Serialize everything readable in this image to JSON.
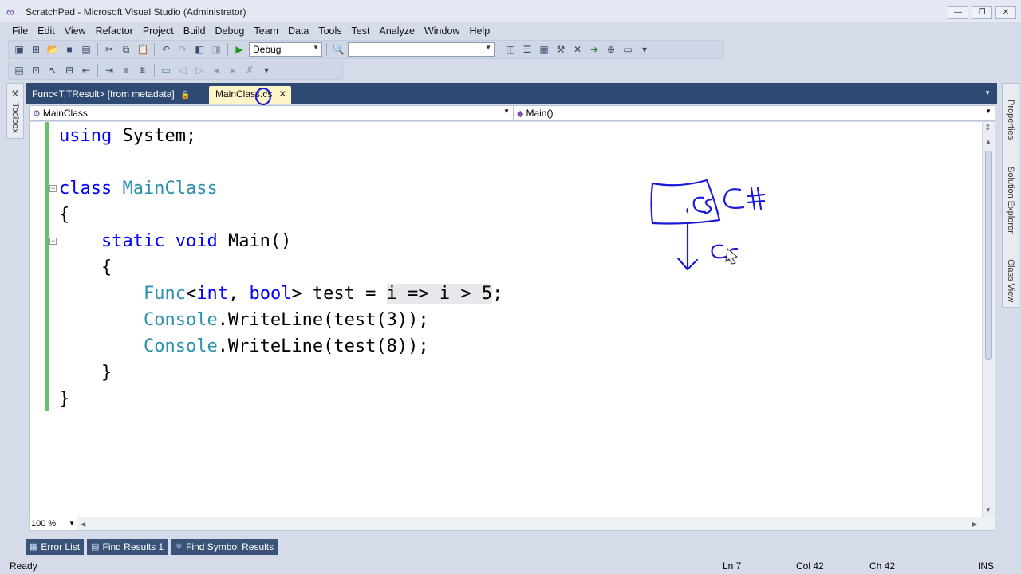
{
  "window": {
    "title": "ScratchPad - Microsoft Visual Studio (Administrator)",
    "minimize": "—",
    "maximize": "❐",
    "close": "✕"
  },
  "menu": [
    "File",
    "Edit",
    "View",
    "Refactor",
    "Project",
    "Build",
    "Debug",
    "Team",
    "Data",
    "Tools",
    "Test",
    "Analyze",
    "Window",
    "Help"
  ],
  "toolbar": {
    "config_value": "Debug",
    "platform_value": ""
  },
  "toolbox": {
    "label": "Toolbox"
  },
  "right_panels": [
    "Properties",
    "Solution Explorer",
    "Class View"
  ],
  "tabs": {
    "inactive_label": "Func<T,TResult> [from metadata]",
    "active_label": "MainClass.cs",
    "close_glyph": "✕"
  },
  "navbar": {
    "class_value": "MainClass",
    "member_value": "Main()"
  },
  "code": {
    "line1_kw": "using",
    "line1_rest": " System;",
    "line3_kw": "class",
    "line3_type": "MainClass",
    "line4": "{",
    "line5_kw1": "static",
    "line5_kw2": "void",
    "line5_rest": " Main()",
    "line6": "{",
    "line7_type": "Func",
    "line7_a": "<",
    "line7_kw1": "int",
    "line7_b": ", ",
    "line7_kw2": "bool",
    "line7_c": "> test = ",
    "line7_hl": "i => i > 5",
    "line7_d": ";",
    "line8_type": "Console",
    "line8_rest": ".WriteLine(test(3));",
    "line9_type": "Console",
    "line9_rest": ".WriteLine(test(8));",
    "line10": "}",
    "line11": "}"
  },
  "zoom": "100 %",
  "bottom_tabs": [
    "Error List",
    "Find Results 1",
    "Find Symbol Results"
  ],
  "status": {
    "ready": "Ready",
    "ln": "Ln 7",
    "col": "Col 42",
    "ch": "Ch 42",
    "ins": "INS"
  },
  "colors": {
    "keyword": "#0000ff",
    "type": "#2b91af",
    "ink": "#1a1ad8",
    "tab_strip": "#2f4a72",
    "active_tab": "#fff5c8"
  }
}
